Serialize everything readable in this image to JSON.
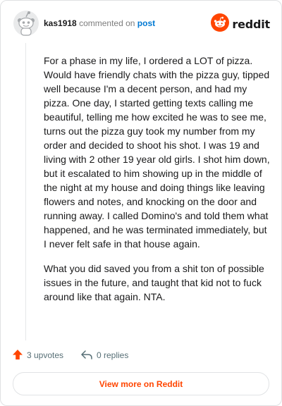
{
  "header": {
    "username": "kas1918",
    "action_text": "commented on",
    "post_link": "post",
    "brand_name": "reddit"
  },
  "comment": {
    "paragraphs": [
      "For a phase in my life, I ordered a LOT of pizza. Would have friendly chats with the pizza guy, tipped well because I'm a decent person, and had my pizza. One day, I started getting texts calling me beautiful, telling me how excited he was to see me, turns out the pizza guy took my number from my order and decided to shoot his shot. I was 19 and living with 2 other 19 year old girls. I shot him down, but it escalated to him showing up in the middle of the night at my house and doing things like leaving flowers and notes, and knocking on the door and running away. I called Domino's and told them what happened, and he was terminated immediately, but I never felt safe in that house again.",
      "What you did saved you from a shit ton of possible issues in the future, and taught that kid not to fuck around like that again. NTA."
    ]
  },
  "actions": {
    "upvotes": "3 upvotes",
    "replies": "0 replies"
  },
  "footer": {
    "view_more": "View more on Reddit"
  },
  "colors": {
    "brand": "#ff4500",
    "link": "#0079d3",
    "text": "#1a1a1b",
    "muted": "#576f76"
  },
  "icons": {
    "avatar": "snoo-avatar-icon",
    "brand": "reddit-logo-icon",
    "upvote": "upvote-arrow-icon",
    "reply": "reply-arrow-icon"
  }
}
